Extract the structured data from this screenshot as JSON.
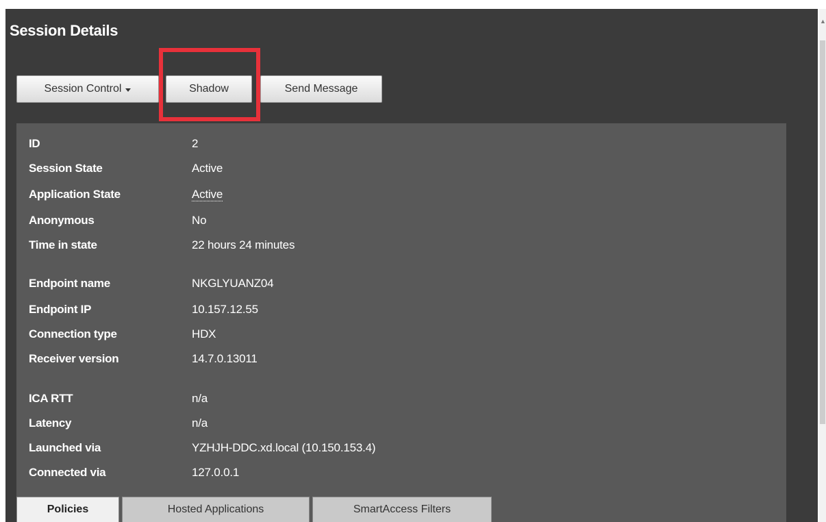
{
  "title": "Session Details",
  "toolbar": {
    "session_control_label": "Session Control",
    "shadow_label": "Shadow",
    "send_message_label": "Send Message"
  },
  "details": {
    "group1": [
      {
        "label": "ID",
        "value": "2"
      },
      {
        "label": "Session State",
        "value": "Active"
      },
      {
        "label": "Application State",
        "value": "Active"
      },
      {
        "label": "Anonymous",
        "value": "No"
      },
      {
        "label": "Time in state",
        "value": "22 hours 24 minutes"
      }
    ],
    "group2": [
      {
        "label": "Endpoint name",
        "value": "NKGLYUANZ04"
      },
      {
        "label": "Endpoint IP",
        "value": "10.157.12.55"
      },
      {
        "label": "Connection type",
        "value": "HDX"
      },
      {
        "label": "Receiver version",
        "value": "14.7.0.13011"
      }
    ],
    "group3": [
      {
        "label": "ICA RTT",
        "value": "n/a"
      },
      {
        "label": "Latency",
        "value": "n/a"
      },
      {
        "label": "Launched via",
        "value": "YZHJH-DDC.xd.local (10.150.153.4)"
      },
      {
        "label": "Connected via",
        "value": "127.0.0.1"
      }
    ]
  },
  "tabs": [
    {
      "label": "Policies",
      "active": true
    },
    {
      "label": "Hosted Applications",
      "active": false
    },
    {
      "label": "SmartAccess Filters",
      "active": false
    }
  ],
  "colors": {
    "panel_bg": "#3b3b3b",
    "details_bg": "#595959",
    "highlight": "#e8313a"
  }
}
